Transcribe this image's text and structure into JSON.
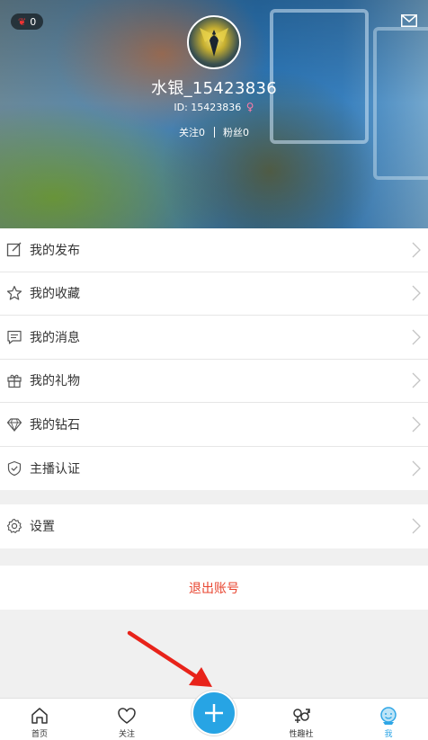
{
  "header": {
    "gift_count": "0",
    "username": "水银_15423836",
    "user_id": "ID: 15423836",
    "gender_symbol": "♀",
    "follow": "关注0",
    "fans": "粉丝0"
  },
  "menu": {
    "items": [
      {
        "label": "我的发布",
        "icon": "edit-icon"
      },
      {
        "label": "我的收藏",
        "icon": "star-icon"
      },
      {
        "label": "我的消息",
        "icon": "message-icon"
      },
      {
        "label": "我的礼物",
        "icon": "gift-icon"
      },
      {
        "label": "我的钻石",
        "icon": "diamond-icon"
      },
      {
        "label": "主播认证",
        "icon": "shield-check-icon"
      }
    ],
    "settings_label": "设置",
    "logout_label": "退出账号"
  },
  "tabbar": {
    "tabs": [
      {
        "label": "首页",
        "icon": "home-icon"
      },
      {
        "label": "关注",
        "icon": "heart-icon"
      },
      {
        "label": "性趣社",
        "icon": "gender-icon"
      },
      {
        "label": "我",
        "icon": "profile-face-icon",
        "active": true
      }
    ],
    "center_button_icon": "plus-icon"
  },
  "colors": {
    "accent": "#27a4e4",
    "logout": "#e8442f",
    "annotation_arrow": "#e8231a"
  }
}
